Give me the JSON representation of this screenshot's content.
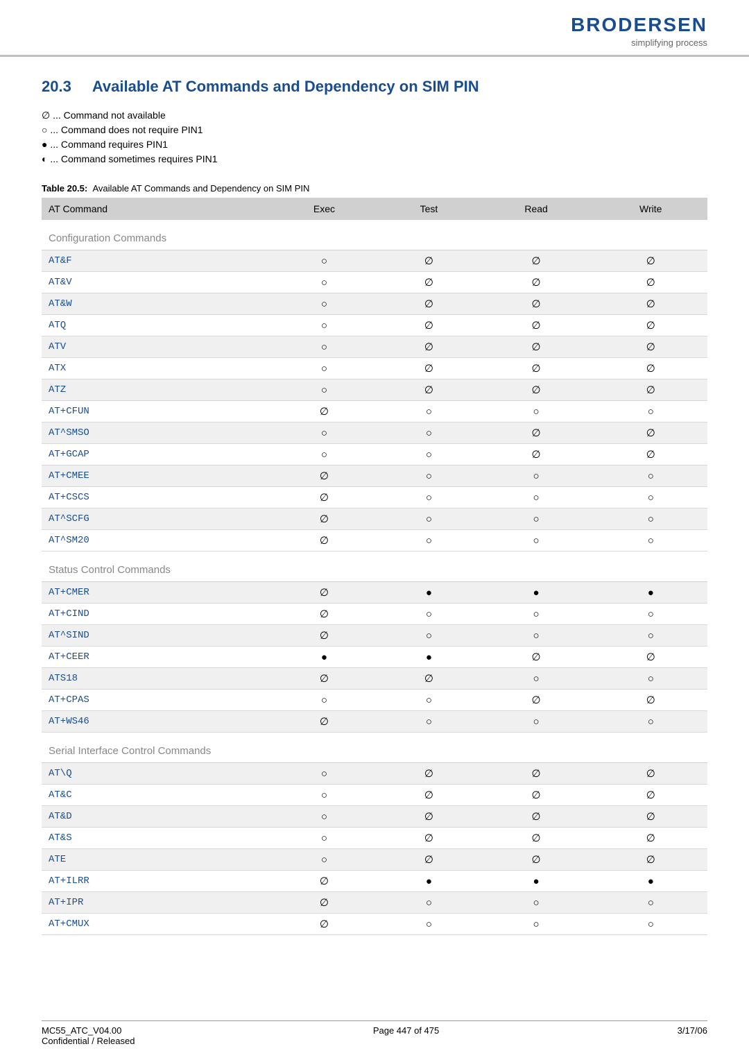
{
  "logo": {
    "brand": "BRODERSEN",
    "tagline": "simplifying process"
  },
  "heading": {
    "number": "20.3",
    "title": "Available AT Commands and Dependency on SIM PIN"
  },
  "legend": {
    "notavail": "∅ ... Command not available",
    "noreq": "○ ... Command does not require PIN1",
    "req": "● ... Command requires PIN1",
    "sometime": "◐ ... Command sometimes requires PIN1"
  },
  "tableCaption": {
    "label": "Table 20.5:",
    "text": "Available AT Commands and Dependency on SIM PIN"
  },
  "columns": [
    "AT Command",
    "Exec",
    "Test",
    "Read",
    "Write"
  ],
  "sections": [
    {
      "title": "Configuration Commands",
      "rows": [
        {
          "cmd": "AT&F",
          "exec": "○",
          "test": "∅",
          "read": "∅",
          "write": "∅"
        },
        {
          "cmd": "AT&V",
          "exec": "○",
          "test": "∅",
          "read": "∅",
          "write": "∅"
        },
        {
          "cmd": "AT&W",
          "exec": "○",
          "test": "∅",
          "read": "∅",
          "write": "∅"
        },
        {
          "cmd": "ATQ",
          "exec": "○",
          "test": "∅",
          "read": "∅",
          "write": "∅"
        },
        {
          "cmd": "ATV",
          "exec": "○",
          "test": "∅",
          "read": "∅",
          "write": "∅"
        },
        {
          "cmd": "ATX",
          "exec": "○",
          "test": "∅",
          "read": "∅",
          "write": "∅"
        },
        {
          "cmd": "ATZ",
          "exec": "○",
          "test": "∅",
          "read": "∅",
          "write": "∅"
        },
        {
          "cmd": "AT+CFUN",
          "exec": "∅",
          "test": "○",
          "read": "○",
          "write": "○"
        },
        {
          "cmd": "AT^SMSO",
          "exec": "○",
          "test": "○",
          "read": "∅",
          "write": "∅"
        },
        {
          "cmd": "AT+GCAP",
          "exec": "○",
          "test": "○",
          "read": "∅",
          "write": "∅"
        },
        {
          "cmd": "AT+CMEE",
          "exec": "∅",
          "test": "○",
          "read": "○",
          "write": "○"
        },
        {
          "cmd": "AT+CSCS",
          "exec": "∅",
          "test": "○",
          "read": "○",
          "write": "○"
        },
        {
          "cmd": "AT^SCFG",
          "exec": "∅",
          "test": "○",
          "read": "○",
          "write": "○"
        },
        {
          "cmd": "AT^SM20",
          "exec": "∅",
          "test": "○",
          "read": "○",
          "write": "○"
        }
      ]
    },
    {
      "title": "Status Control Commands",
      "rows": [
        {
          "cmd": "AT+CMER",
          "exec": "∅",
          "test": "●",
          "read": "●",
          "write": "●"
        },
        {
          "cmd": "AT+CIND",
          "exec": "∅",
          "test": "○",
          "read": "○",
          "write": "○"
        },
        {
          "cmd": "AT^SIND",
          "exec": "∅",
          "test": "○",
          "read": "○",
          "write": "○"
        },
        {
          "cmd": "AT+CEER",
          "exec": "●",
          "test": "●",
          "read": "∅",
          "write": "∅"
        },
        {
          "cmd": "ATS18",
          "exec": "∅",
          "test": "∅",
          "read": "○",
          "write": "○"
        },
        {
          "cmd": "AT+CPAS",
          "exec": "○",
          "test": "○",
          "read": "∅",
          "write": "∅"
        },
        {
          "cmd": "AT+WS46",
          "exec": "∅",
          "test": "○",
          "read": "○",
          "write": "○"
        }
      ]
    },
    {
      "title": "Serial Interface Control Commands",
      "rows": [
        {
          "cmd": "AT\\Q",
          "exec": "○",
          "test": "∅",
          "read": "∅",
          "write": "∅"
        },
        {
          "cmd": "AT&C",
          "exec": "○",
          "test": "∅",
          "read": "∅",
          "write": "∅"
        },
        {
          "cmd": "AT&D",
          "exec": "○",
          "test": "∅",
          "read": "∅",
          "write": "∅"
        },
        {
          "cmd": "AT&S",
          "exec": "○",
          "test": "∅",
          "read": "∅",
          "write": "∅"
        },
        {
          "cmd": "ATE",
          "exec": "○",
          "test": "∅",
          "read": "∅",
          "write": "∅"
        },
        {
          "cmd": "AT+ILRR",
          "exec": "∅",
          "test": "●",
          "read": "●",
          "write": "●"
        },
        {
          "cmd": "AT+IPR",
          "exec": "∅",
          "test": "○",
          "read": "○",
          "write": "○"
        },
        {
          "cmd": "AT+CMUX",
          "exec": "∅",
          "test": "○",
          "read": "○",
          "write": "○"
        }
      ]
    }
  ],
  "footer": {
    "left1": "MC55_ATC_V04.00",
    "left2": "Confidential / Released",
    "center": "Page 447 of 475",
    "right": "3/17/06"
  }
}
